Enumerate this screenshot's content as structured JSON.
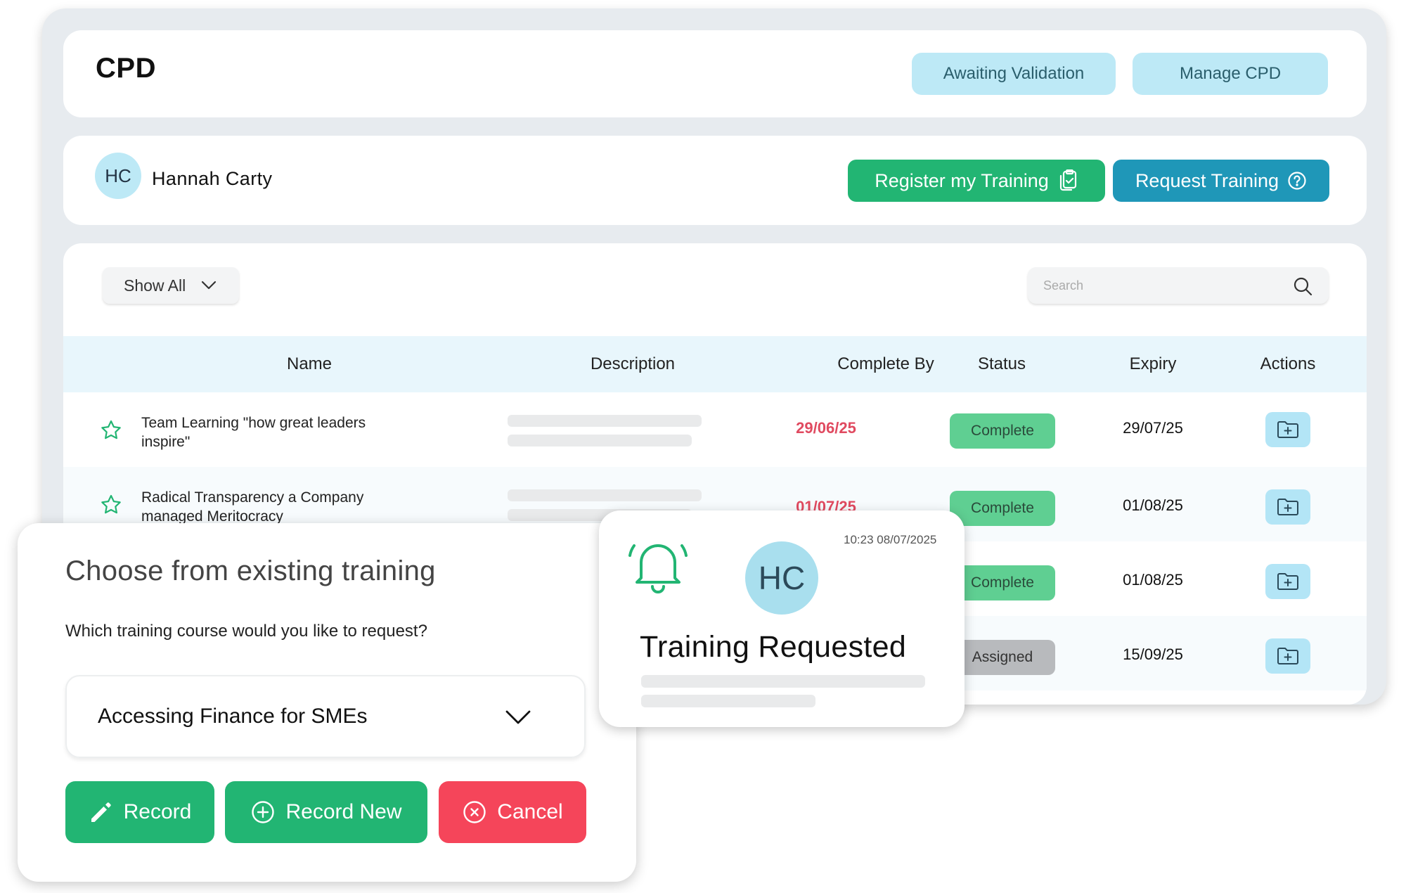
{
  "header": {
    "title": "CPD",
    "awaiting_label": "Awaiting Validation",
    "manage_label": "Manage CPD"
  },
  "user": {
    "initials": "HC",
    "name": "Hannah Carty",
    "register_label": "Register my Training",
    "request_label": "Request Training"
  },
  "filters": {
    "show_label": "Show All",
    "search_placeholder": "Search"
  },
  "table": {
    "columns": [
      "Name",
      "Description",
      "Complete By",
      "Status",
      "Expiry",
      "Actions"
    ],
    "rows": [
      {
        "name": "Team Learning \"how great leaders inspire\"",
        "complete_by": "29/06/25",
        "status": "Complete",
        "expiry": "29/07/25"
      },
      {
        "name": "Radical Transparency a Company managed Meritocracy",
        "complete_by": "01/07/25",
        "status": "Complete",
        "expiry": "01/08/25"
      },
      {
        "name": "",
        "complete_by": "",
        "status": "Complete",
        "expiry": "01/08/25"
      },
      {
        "name": "",
        "complete_by": "",
        "status": "Assigned",
        "expiry": "15/09/25"
      }
    ]
  },
  "modal": {
    "title": "Choose from existing training",
    "question": "Which training course would you like to request?",
    "selected_course": "Accessing Finance for SMEs",
    "record_label": "Record",
    "record_new_label": "Record New",
    "cancel_label": "Cancel"
  },
  "notification": {
    "timestamp": "10:23 08/07/2025",
    "initials": "HC",
    "title": "Training Requested"
  },
  "colors": {
    "green": "#22b573",
    "teal": "#1f97b8",
    "light_blue": "#bde9f6",
    "red": "#f5455a",
    "date_red": "#e04a60",
    "badge_green": "#5fcf92",
    "badge_grey": "#b8babd"
  },
  "icons": [
    "clipboard-check-icon",
    "question-circle-icon",
    "chevron-down-icon",
    "search-icon",
    "star-icon",
    "folder-plus-icon",
    "pencil-icon",
    "plus-circle-icon",
    "x-circle-icon",
    "bell-icon"
  ]
}
